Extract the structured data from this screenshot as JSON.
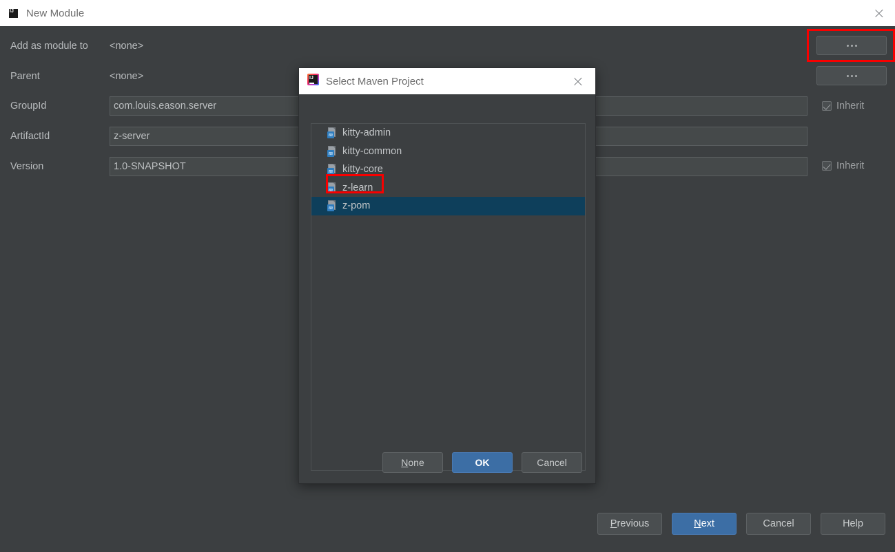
{
  "window": {
    "title": "New Module",
    "app_icon": "intellij-idea-icon",
    "close_icon": "close-icon",
    "background_color": "#3c3f41"
  },
  "form": {
    "rows": [
      {
        "label": "Add as module to",
        "value": "<none>",
        "type": "plain"
      },
      {
        "label": "Parent",
        "value": "<none>",
        "type": "plain"
      },
      {
        "label": "GroupId",
        "value": "com.louis.eason.server",
        "type": "field"
      },
      {
        "label": "ArtifactId",
        "value": "z-server",
        "type": "field"
      },
      {
        "label": "Version",
        "value": "1.0-SNAPSHOT",
        "type": "field"
      }
    ],
    "browse_buttons": [
      {
        "name": "browse-add-as-module-to",
        "label": "...",
        "highlighted": true
      },
      {
        "name": "browse-parent",
        "label": "...",
        "highlighted": false
      }
    ],
    "inherit_checkboxes": [
      {
        "label": "Inherit",
        "checked": true
      },
      {
        "label": "Inherit",
        "checked": true
      }
    ]
  },
  "dialog": {
    "title": "Select Maven Project",
    "app_icon": "intellij-idea-icon",
    "close_icon": "close-icon",
    "items": [
      {
        "label": "kitty-admin",
        "icon": "maven-project-icon",
        "selected": false,
        "highlighted": false
      },
      {
        "label": "kitty-common",
        "icon": "maven-project-icon",
        "selected": false,
        "highlighted": false
      },
      {
        "label": "kitty-core",
        "icon": "maven-project-icon",
        "selected": false,
        "highlighted": false
      },
      {
        "label": "z-learn",
        "icon": "maven-project-icon",
        "selected": false,
        "highlighted": false
      },
      {
        "label": "z-pom",
        "icon": "maven-project-icon",
        "selected": true,
        "highlighted": true
      }
    ],
    "buttons": {
      "none": {
        "label": "None",
        "mnemonic": "N"
      },
      "ok": {
        "label": "OK",
        "primary": true
      },
      "cancel": {
        "label": "Cancel"
      }
    },
    "selection_color": "#0e3f5b"
  },
  "wizard_buttons": {
    "previous": {
      "label": "Previous",
      "mnemonic": "P"
    },
    "next": {
      "label": "Next",
      "mnemonic": "N",
      "primary": true
    },
    "cancel": {
      "label": "Cancel"
    },
    "help": {
      "label": "Help"
    }
  },
  "annotations": {
    "highlight_color": "#f80000",
    "boxes": [
      {
        "target": "browse-add-as-module-to"
      },
      {
        "target": "list-item-z-pom"
      }
    ]
  }
}
